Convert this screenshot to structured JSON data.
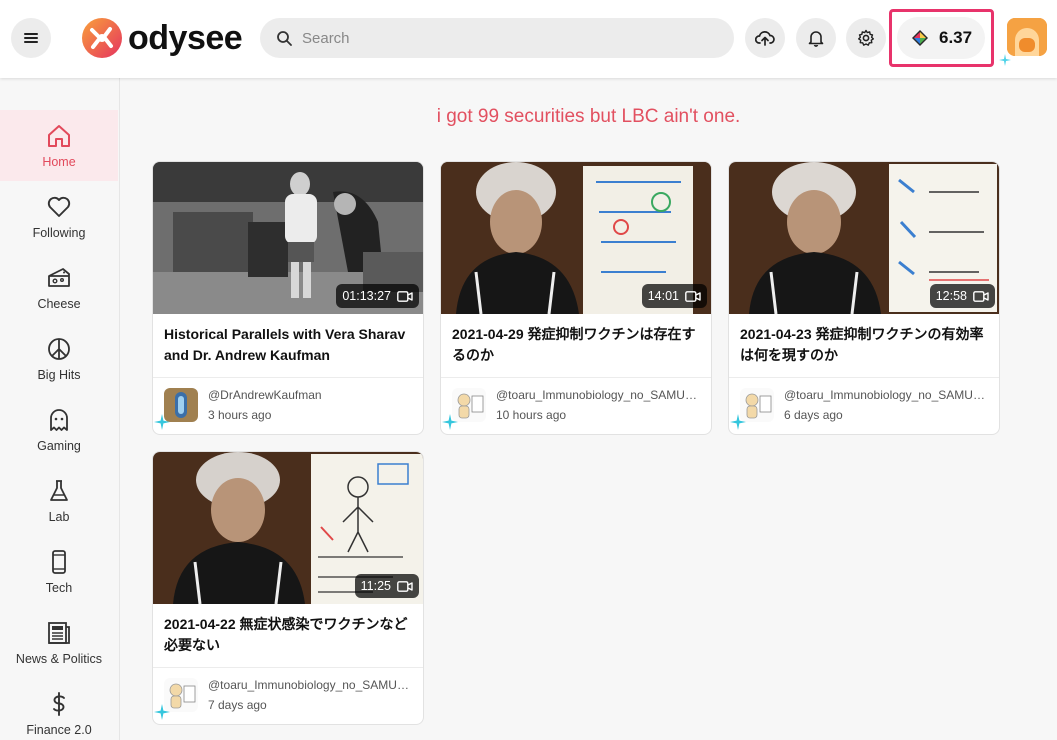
{
  "header": {
    "logo_text": "odysee",
    "search_placeholder": "Search",
    "balance": "6.37"
  },
  "sidebar": {
    "items": [
      {
        "label": "Home",
        "icon": "home-icon",
        "active": true
      },
      {
        "label": "Following",
        "icon": "heart-icon"
      },
      {
        "label": "Cheese",
        "icon": "cheese-icon"
      },
      {
        "label": "Big Hits",
        "icon": "peace-icon"
      },
      {
        "label": "Gaming",
        "icon": "ghost-icon"
      },
      {
        "label": "Lab",
        "icon": "flask-icon"
      },
      {
        "label": "Tech",
        "icon": "phone-icon"
      },
      {
        "label": "News & Politics",
        "icon": "newspaper-icon"
      },
      {
        "label": "Finance 2.0",
        "icon": "dollar-icon"
      }
    ]
  },
  "main": {
    "tagline": "i got 99 securities but LBC ain't one.",
    "cards": [
      {
        "title": "Historical Parallels with Vera Sharav and Dr. Andrew Kaufman",
        "duration": "01:13:27",
        "channel": "@DrAndrewKaufman",
        "time": "3 hours ago"
      },
      {
        "title": "2021-04-29 発症抑制ワクチンは存在するのか",
        "duration": "14:01",
        "channel": "@toaru_Immunobiology_no_SAMURAI",
        "time": "10 hours ago"
      },
      {
        "title": "2021-04-23 発症抑制ワクチンの有効率は何を現すのか",
        "duration": "12:58",
        "channel": "@toaru_Immunobiology_no_SAMURAI",
        "time": "6 days ago"
      },
      {
        "title": "2021-04-22 無症状感染でワクチンなど必要ない",
        "duration": "11:25",
        "channel": "@toaru_Immunobiology_no_SAMURAI",
        "time": "7 days ago"
      }
    ]
  },
  "colors": {
    "accent": "#e2495b",
    "highlight_box": "#e8336b"
  }
}
